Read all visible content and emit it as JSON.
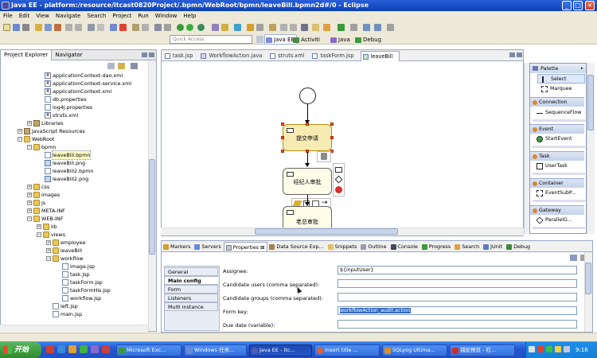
{
  "window": {
    "title": "Java EE - platform:/resource/itcast0820Project/.bpmn/WebRoot/bpmn/leaveBill.bpmn2d#/0 - Eclipse"
  },
  "menu": [
    "File",
    "Edit",
    "View",
    "Navigate",
    "Search",
    "Project",
    "Run",
    "Window",
    "Help"
  ],
  "toolbar": {
    "quick_access_placeholder": "Quick Access"
  },
  "perspectives": [
    {
      "label": "Java EE",
      "active": true
    },
    {
      "label": "Activiti",
      "active": false
    },
    {
      "label": "Java",
      "active": false
    },
    {
      "label": "Debug",
      "active": false
    }
  ],
  "left_panel": {
    "tabs": [
      {
        "label": "Project Explorer",
        "active": true
      },
      {
        "label": "Navigator",
        "active": false
      }
    ],
    "tree": [
      {
        "label": "applicationContext-dao.xml",
        "icon": "xml-file-icon"
      },
      {
        "label": "applicationContext-service.xml",
        "icon": "xml-file-icon"
      },
      {
        "label": "applicationContext.xml",
        "icon": "xml-file-icon"
      },
      {
        "label": "db.properties",
        "icon": "file-icon"
      },
      {
        "label": "log4j.properties",
        "icon": "file-icon"
      },
      {
        "label": "struts.xml",
        "icon": "xml-file-icon"
      },
      {
        "label": "Libraries",
        "icon": "library-icon"
      },
      {
        "label": "JavaScript Resources",
        "icon": "library-icon"
      },
      {
        "label": "WebRoot",
        "icon": "folder-icon"
      },
      {
        "label": "bpmn",
        "icon": "folder-icon"
      },
      {
        "label": "leaveBill.bpmn",
        "icon": "file-icon"
      },
      {
        "label": "leaveBill.png",
        "icon": "image-icon"
      },
      {
        "label": "leaveBill2.bpmn",
        "icon": "file-icon"
      },
      {
        "label": "leaveBill2.png",
        "icon": "image-icon"
      },
      {
        "label": "css",
        "icon": "folder-icon"
      },
      {
        "label": "images",
        "icon": "folder-icon"
      },
      {
        "label": "js",
        "icon": "folder-icon"
      },
      {
        "label": "META-INF",
        "icon": "folder-icon"
      },
      {
        "label": "WEB-INF",
        "icon": "folder-icon"
      },
      {
        "label": "lib",
        "icon": "folder-icon"
      },
      {
        "label": "views",
        "icon": "folder-icon"
      },
      {
        "label": "employee",
        "icon": "folder-icon"
      },
      {
        "label": "leaveBill",
        "icon": "folder-icon"
      },
      {
        "label": "workflow",
        "icon": "folder-icon"
      },
      {
        "label": "image.jsp",
        "icon": "file-icon"
      },
      {
        "label": "task.jsp",
        "icon": "file-icon"
      },
      {
        "label": "taskForm.jsp",
        "icon": "file-icon"
      },
      {
        "label": "taskFormHis.jsp",
        "icon": "file-icon"
      },
      {
        "label": "workflow.jsp",
        "icon": "file-icon"
      },
      {
        "label": "left.jsp",
        "icon": "file-icon"
      },
      {
        "label": "main.jsp",
        "icon": "file-icon"
      }
    ]
  },
  "editor": {
    "tabs": [
      {
        "label": "task.jsp",
        "active": false
      },
      {
        "label": "WorkflowAction.java",
        "active": false
      },
      {
        "label": "struts.xml",
        "active": false
      },
      {
        "label": "taskForm.jsp",
        "active": false
      },
      {
        "label": "leaveBill",
        "active": true
      }
    ],
    "diagram": {
      "nodes": [
        {
          "label": "提交申请",
          "selected": true
        },
        {
          "label": "经纪人审批",
          "selected": false
        },
        {
          "label": "老总审批",
          "selected": false
        }
      ]
    }
  },
  "palette": {
    "title": "Palette",
    "tools": [
      {
        "label": "Select",
        "selected": true
      },
      {
        "label": "Marquee",
        "selected": false
      }
    ],
    "sections": [
      {
        "label": "Connection",
        "items": [
          "SequenceFlow"
        ]
      },
      {
        "label": "Event",
        "items": [
          "StartEvent"
        ]
      },
      {
        "label": "Task",
        "items": [
          "UserTask"
        ]
      },
      {
        "label": "Container",
        "items": [
          "EventSubP..."
        ]
      },
      {
        "label": "Gateway",
        "items": [
          "ParallelG..."
        ]
      }
    ]
  },
  "bottom_panel": {
    "tabs": [
      {
        "label": "Markers",
        "active": false
      },
      {
        "label": "Servers",
        "active": false
      },
      {
        "label": "Properties",
        "active": true
      },
      {
        "label": "Data Source Exp...",
        "active": false
      },
      {
        "label": "Snippets",
        "active": false
      },
      {
        "label": "Outline",
        "active": false
      },
      {
        "label": "Console",
        "active": false
      },
      {
        "label": "Progress",
        "active": false
      },
      {
        "label": "Search",
        "active": false
      },
      {
        "label": "JUnit",
        "active": false
      },
      {
        "label": "Debug",
        "active": false
      }
    ],
    "property_tabs": [
      {
        "label": "General",
        "active": false
      },
      {
        "label": "Main config",
        "active": true
      },
      {
        "label": "Form",
        "active": false
      },
      {
        "label": "Listeners",
        "active": false
      },
      {
        "label": "Multi instance",
        "active": false
      }
    ],
    "fields": [
      {
        "label": "Assignee:",
        "value": "${inputUser}"
      },
      {
        "label": "Candidate users (comma separated):",
        "value": ""
      },
      {
        "label": "Candidate groups (comma separated):",
        "value": ""
      },
      {
        "label": "Form key:",
        "value": "workflowAction_audit.action"
      },
      {
        "label": "Due date (variable):",
        "value": ""
      }
    ]
  },
  "taskbar": {
    "start_label": "开始",
    "items": [
      {
        "label": "Microsoft Exc...",
        "active": false
      },
      {
        "label": "Windows 任务...",
        "active": false
      },
      {
        "label": "Java EE - itc...",
        "active": true
      },
      {
        "label": "Insert title ...",
        "active": false
      },
      {
        "label": "SQLyog Ultima...",
        "active": false
      },
      {
        "label": "捕捉预览 - 红...",
        "active": false
      }
    ],
    "clock": "9:16"
  },
  "colors": {
    "accent": "#0a3fb5",
    "selection": "#316ac5",
    "task_highlight": "#f7ebb4"
  }
}
